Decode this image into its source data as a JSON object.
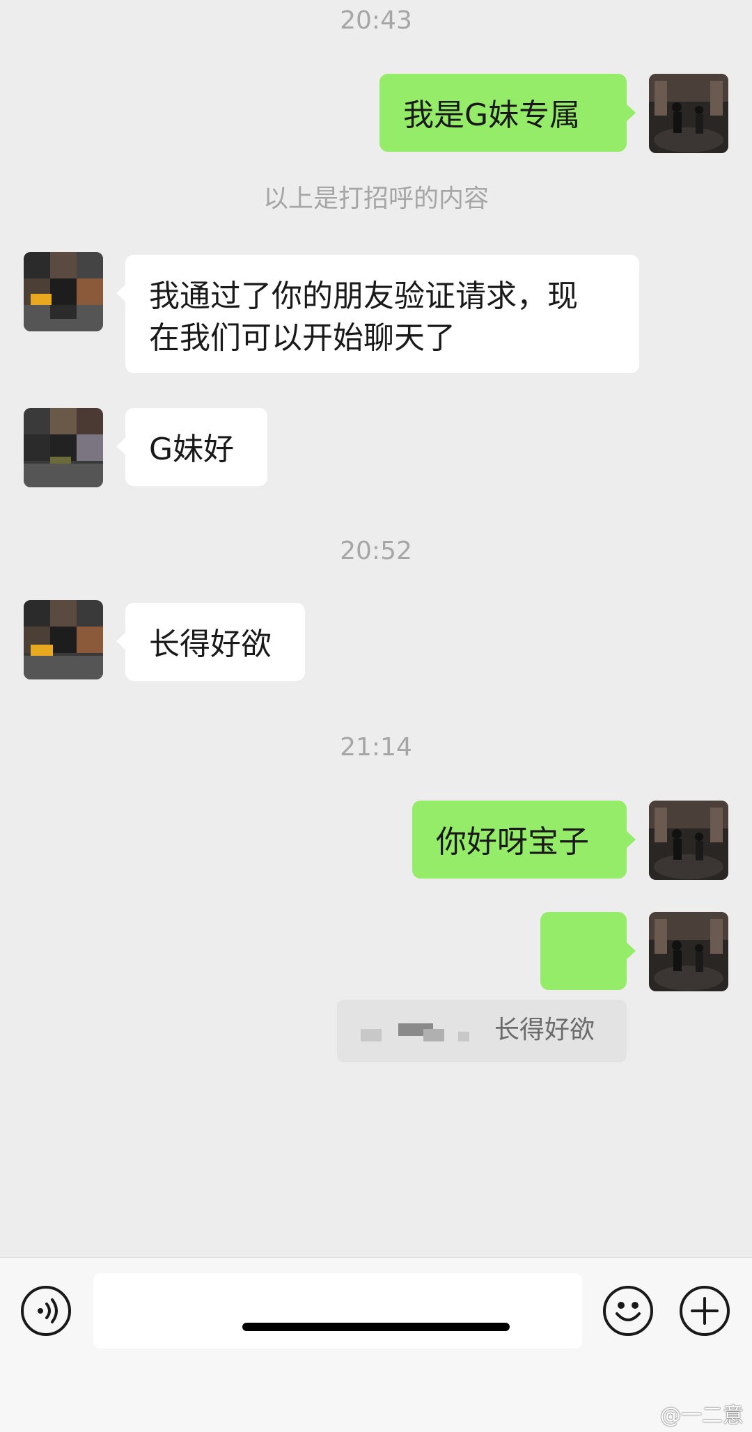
{
  "timestamps": {
    "t1": "20:43",
    "t2": "20:52",
    "t3": "21:14"
  },
  "system_notice": "以上是打招呼的内容",
  "messages": {
    "m1": "我是G妹专属",
    "m2": "我通过了你的朋友验证请求，现\n在我们可以开始聊天了",
    "m3": "G妹好",
    "m4": "长得好欲",
    "m5": "你好呀宝子",
    "m6_emoji": "🫣"
  },
  "quote": {
    "text": "长得好欲"
  },
  "icons": {
    "voice": "voice-icon",
    "emoji": "emoji-icon",
    "plus": "plus-icon"
  },
  "watermark": "@一二意",
  "colors": {
    "sent_bubble": "#95ec69",
    "received_bubble": "#ffffff",
    "background": "#ededed"
  }
}
